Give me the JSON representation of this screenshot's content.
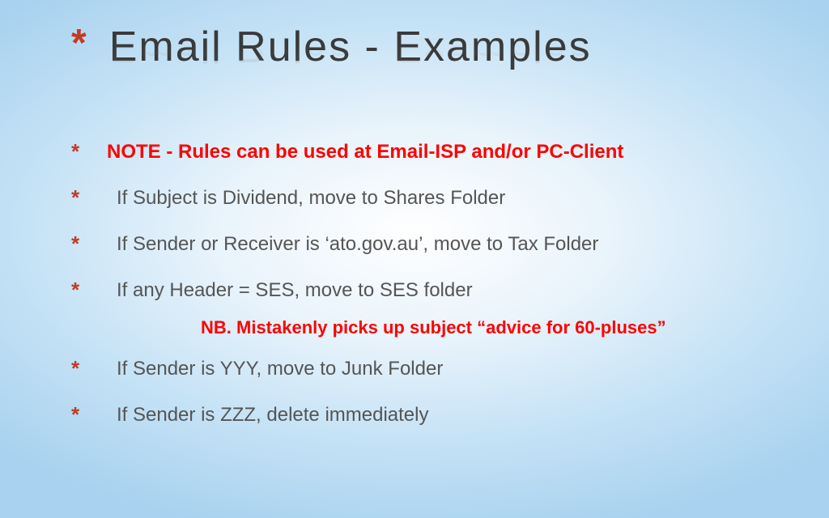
{
  "title": "Email  Rules  -  Examples",
  "bullets": [
    {
      "text": "NOTE -  Rules can be used at  Email-ISP   and/or  PC-Client",
      "class": "note",
      "indent": false
    },
    {
      "text": "If  Subject  is  Dividend,    move to Shares Folder",
      "class": "",
      "indent": true
    },
    {
      "text": "If  Sender or Receiver is  ‘ato.gov.au’,  move to Tax Folder",
      "class": "",
      "indent": true
    },
    {
      "text": "If any Header =  SES,  move to SES folder",
      "class": "",
      "indent": true
    },
    {
      "subnote": "NB.  Mistakenly picks up subject  “advice for 60-pluses”"
    },
    {
      "text": "If  Sender is   YYY,    move to Junk Folder",
      "class": "",
      "indent": true
    },
    {
      "text": "If  Sender is   ZZZ,    delete immediately",
      "class": "",
      "indent": true
    }
  ]
}
